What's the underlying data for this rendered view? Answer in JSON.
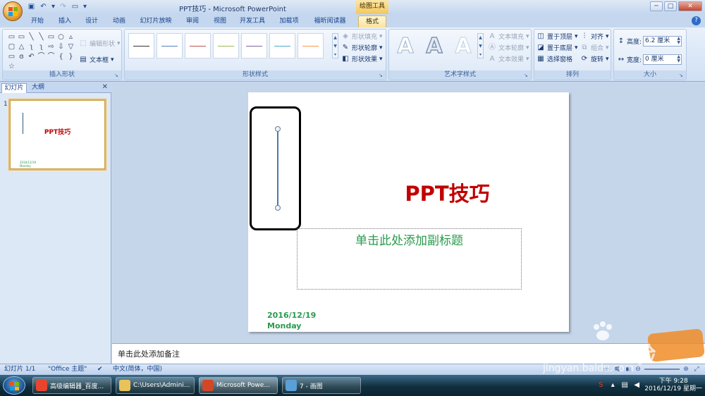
{
  "window": {
    "title": "PPT技巧 - Microsoft PowerPoint",
    "context_tab_header": "绘图工具",
    "controls": [
      "─",
      "□",
      "✕"
    ],
    "inner_controls": [
      "─",
      "□",
      "✕"
    ]
  },
  "tabs": [
    {
      "label": "开始"
    },
    {
      "label": "插入"
    },
    {
      "label": "设计"
    },
    {
      "label": "动画"
    },
    {
      "label": "幻灯片放映"
    },
    {
      "label": "审阅"
    },
    {
      "label": "视图"
    },
    {
      "label": "开发工具"
    },
    {
      "label": "加载项"
    },
    {
      "label": "福昕阅读器"
    },
    {
      "label": "格式",
      "active": true
    }
  ],
  "ribbon": {
    "insert_shapes": {
      "label": "插入形状",
      "edit_shape": "编辑形状",
      "textbox": "文本框",
      "shapes": [
        "▭",
        "▭",
        "╲",
        "╲",
        "▭",
        "○",
        "▵",
        "▢",
        "△",
        "ʅ",
        "ʅ",
        "⇨",
        "⇩",
        "▽",
        "▭",
        "ɞ",
        "↶",
        "⌒",
        "⌒",
        "{",
        "}",
        "☆"
      ]
    },
    "shape_styles": {
      "label": "形状样式",
      "fill": "形状填充",
      "outline": "形状轮廓",
      "effects": "形状效果",
      "swatch_colors": [
        "#333333",
        "#4f81bd",
        "#c0504d",
        "#9bbb59",
        "#8064a2",
        "#4bacc6",
        "#f79646"
      ]
    },
    "wordart": {
      "label": "艺术字样式",
      "text_fill": "文本填充",
      "text_outline": "文本轮廓",
      "text_effects": "文本效果",
      "letters": [
        "A",
        "A",
        "A"
      ]
    },
    "arrange": {
      "label": "排列",
      "bring_front": "置于顶层",
      "send_back": "置于底层",
      "selection_pane": "选择窗格",
      "align": "对齐",
      "group": "组合",
      "rotate": "旋转"
    },
    "size": {
      "label": "大小",
      "height_label": "高度:",
      "height_value": "6.2 厘米",
      "width_label": "宽度:",
      "width_value": "0 厘米"
    }
  },
  "left_pane": {
    "tab_slides": "幻灯片",
    "tab_outline": "大纲",
    "thumb_number": "1",
    "thumb_title": "PPT技巧",
    "thumb_date": "2016/12/19",
    "thumb_day": "Monday"
  },
  "slide": {
    "title": "PPT技巧",
    "subtitle_placeholder": "单击此处添加副标题",
    "date": "2016/12/19",
    "day": "Monday"
  },
  "notes": {
    "placeholder": "单击此处添加备注"
  },
  "status": {
    "slide_count": "幻灯片 1/1",
    "theme": "\"Office 主题\"",
    "language": "中文(简体，中国)"
  },
  "taskbar": {
    "tasks": [
      {
        "label": "高级编辑器_百度...",
        "color": "#e9452e"
      },
      {
        "label": "C:\\Users\\Admini...",
        "color": "#e8c35a"
      },
      {
        "label": "Microsoft Powe...",
        "color": "#d24726",
        "active": true
      },
      {
        "label": "7 - 画图",
        "color": "#5aa0d8"
      }
    ],
    "time": "下午 9:28",
    "date": "2016/12/19 星期一"
  },
  "watermark": {
    "brand": "Baidu经验",
    "url": "jingyan.baidu.com"
  },
  "colors": {
    "title_red": "#c00000",
    "green_text": "#2a9a4c",
    "line_blue": "#4a7aa8",
    "ribbon_blue": "#15428b"
  }
}
